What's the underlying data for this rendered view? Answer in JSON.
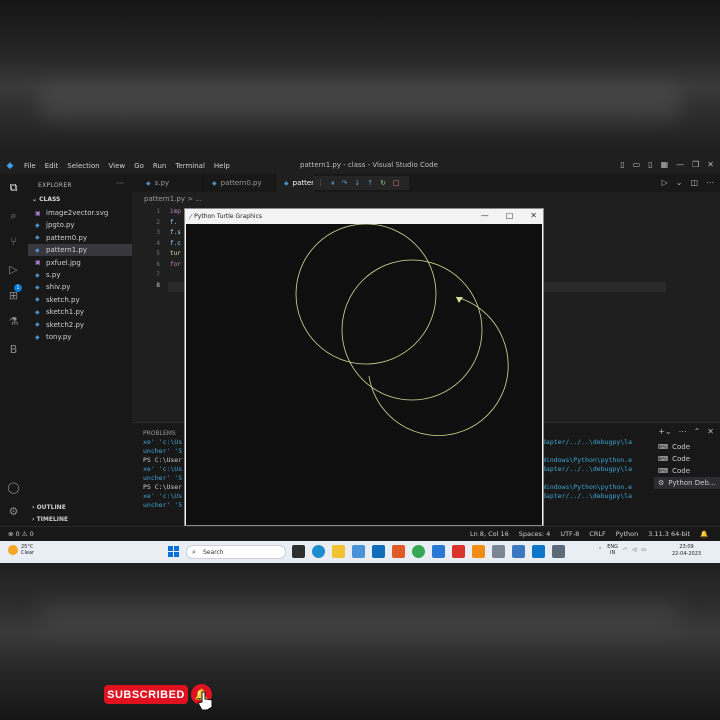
{
  "vscode": {
    "menu": [
      "File",
      "Edit",
      "Selection",
      "View",
      "Go",
      "Run",
      "Terminal",
      "Help"
    ],
    "window_title": "pattern1.py - class - Visual Studio Code",
    "sidebar": {
      "header": "EXPLORER",
      "more": "···",
      "folder": "CLASS",
      "files": [
        {
          "name": "image2vector.svg",
          "icon": "svg-file-icon"
        },
        {
          "name": "jpgto.py",
          "icon": "python-file-icon"
        },
        {
          "name": "pattern0.py",
          "icon": "python-file-icon"
        },
        {
          "name": "pattern1.py",
          "icon": "python-file-icon",
          "selected": true
        },
        {
          "name": "pxfuel.jpg",
          "icon": "image-file-icon"
        },
        {
          "name": "s.py",
          "icon": "python-file-icon"
        },
        {
          "name": "shiv.py",
          "icon": "python-file-icon"
        },
        {
          "name": "sketch.py",
          "icon": "python-file-icon"
        },
        {
          "name": "sketch1.py",
          "icon": "python-file-icon"
        },
        {
          "name": "sketch2.py",
          "icon": "python-file-icon"
        },
        {
          "name": "tony.py",
          "icon": "python-file-icon"
        }
      ],
      "outline": "OUTLINE",
      "timeline": "TIMELINE"
    },
    "tabs": [
      "s.py",
      "pattern0.py",
      "patter"
    ],
    "breadcrumb": "pattern1.py > ...",
    "line_numbers": [
      "1",
      "2",
      "3",
      "4",
      "5",
      "6",
      "7",
      "8"
    ],
    "code_lines": [
      "imp",
      "f.",
      "f.s",
      "f.c",
      "tur",
      "for",
      "",
      ""
    ],
    "panel": {
      "tab": "PROBLEMS",
      "terminal_left": [
        "xe' 'c:\\Us",
        "uncher' '5",
        "PS C:\\User",
        "xe' 'c:\\Us",
        "uncher' '5",
        "PS C:\\User",
        "xe' 'c:\\Us",
        "uncher' '5"
      ],
      "terminal_right": [
        "dapter/../..\\debugpy\\la",
        "",
        "Windows\\Python\\python.e",
        "dapter/../..\\debugpy\\la",
        "",
        "Windows\\Python\\python.e",
        "dapter/../..\\debugpy\\la",
        ""
      ],
      "terminals": [
        "Code",
        "Code",
        "Code",
        "Python Deb..."
      ]
    },
    "status": {
      "left": "⊗ 0 ⚠ 0",
      "position": "Ln 8, Col 16",
      "spaces": "Spaces: 4",
      "encoding": "UTF-8",
      "eol": "CRLF",
      "language": "Python",
      "interpreter": "3.11.3 64-bit"
    }
  },
  "turtle": {
    "title": "Python Turtle Graphics",
    "stroke_color": "#d8dd9a"
  },
  "taskbar": {
    "weather_temp": "25°C",
    "weather_desc": "Clear",
    "search": "Search",
    "lang": "ENG",
    "region": "IN",
    "time": "23:09",
    "date": "22-04-2023"
  },
  "overlay": {
    "subscribed": "SUBSCRIBED"
  }
}
